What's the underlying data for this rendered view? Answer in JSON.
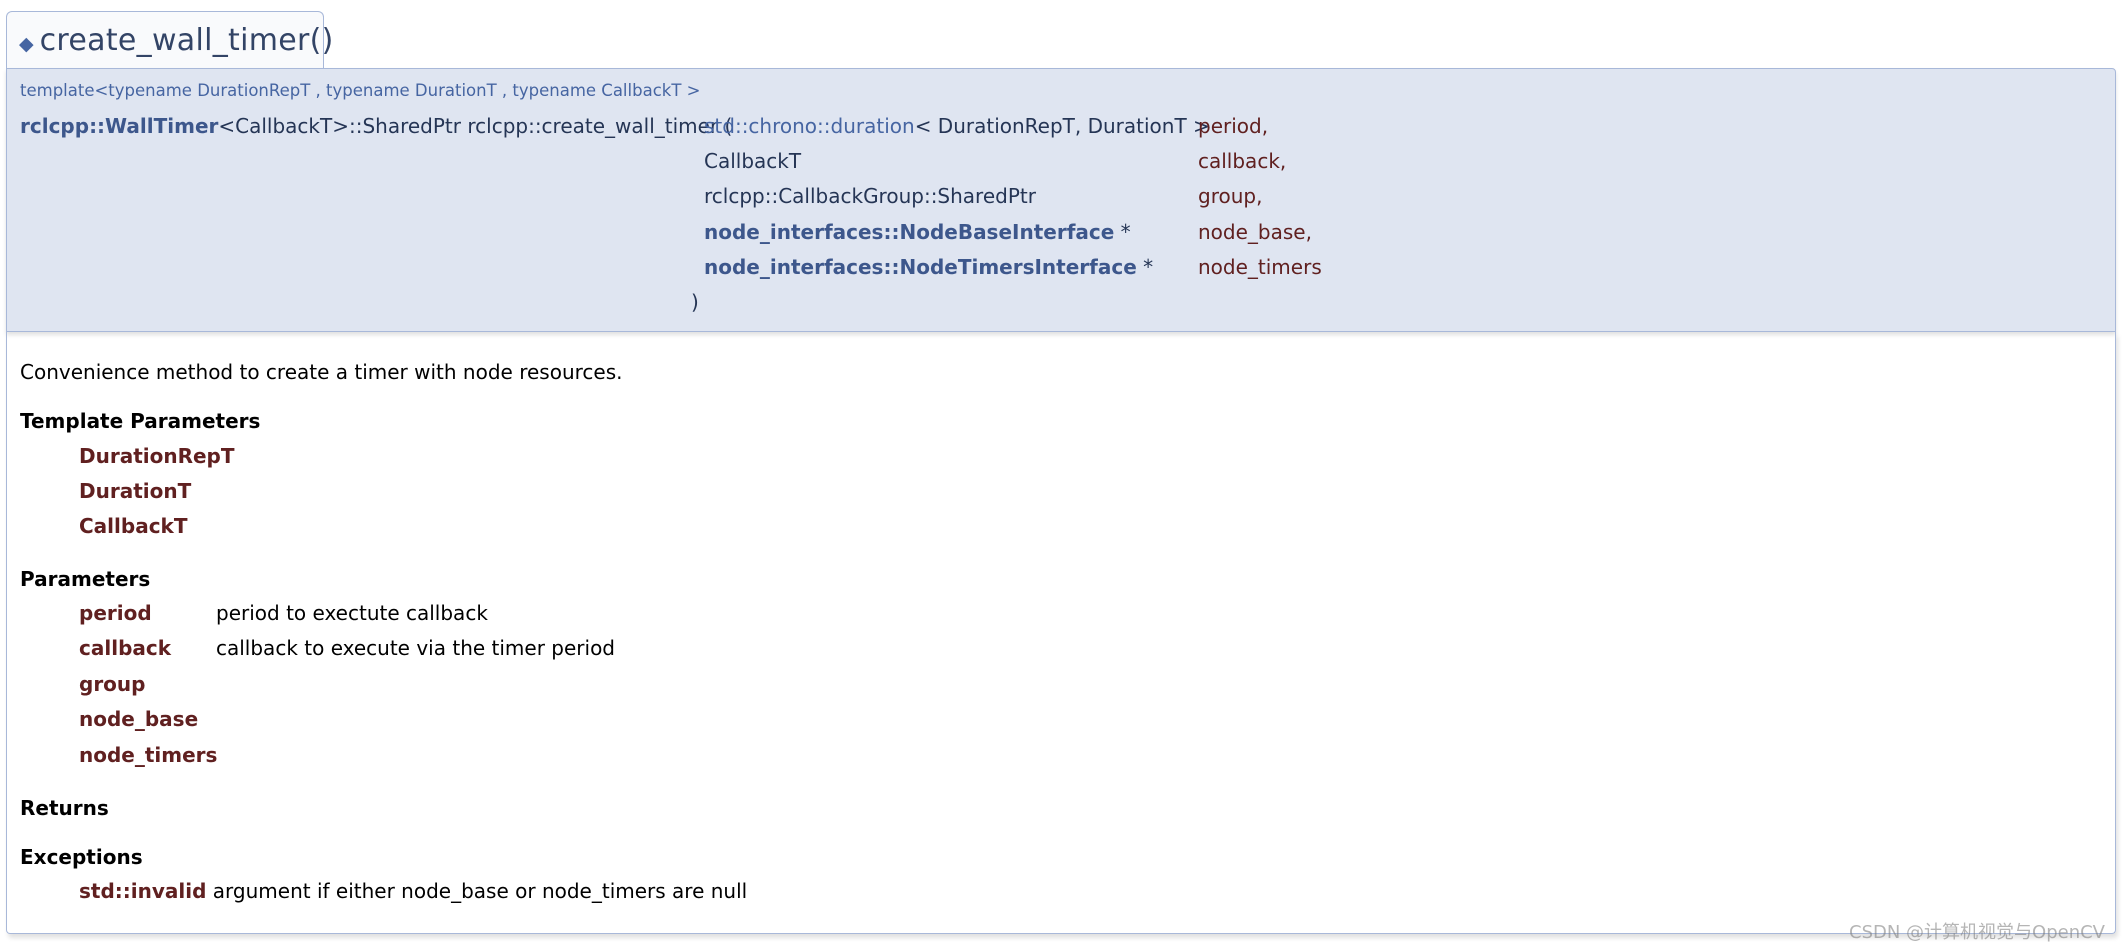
{
  "header": {
    "diamond": "◆",
    "title": "create_wall_timer()"
  },
  "prototype": {
    "template": "template<typename DurationRepT , typename DurationT , typename CallbackT >",
    "return_type_link": "rclcpp::WallTimer",
    "return_type_rest": "<CallbackT>::SharedPtr rclcpp::create_wall_timer (",
    "params": [
      {
        "type_link": "std::chrono::duration",
        "type_rest": "< DurationRepT, DurationT >",
        "name": "period,"
      },
      {
        "type_link": "",
        "type_rest": "CallbackT",
        "name": "callback,"
      },
      {
        "type_link": "",
        "type_rest": "rclcpp::CallbackGroup::SharedPtr",
        "name": "group,"
      },
      {
        "type_link": "node_interfaces::NodeBaseInterface",
        "type_rest": " *",
        "name": "node_base,"
      },
      {
        "type_link": "node_interfaces::NodeTimersInterface",
        "type_rest": " *",
        "name": "node_timers"
      }
    ],
    "close_paren": ")"
  },
  "doc": {
    "description": "Convenience method to create a timer with node resources.",
    "template_params_heading": "Template Parameters",
    "template_params": [
      "DurationRepT",
      "DurationT",
      "CallbackT"
    ],
    "params_heading": "Parameters",
    "params": [
      {
        "name": "period",
        "desc": "period to exectute callback"
      },
      {
        "name": "callback",
        "desc": "callback to execute via the timer period"
      },
      {
        "name": "group",
        "desc": ""
      },
      {
        "name": "node_base",
        "desc": ""
      },
      {
        "name": "node_timers",
        "desc": ""
      }
    ],
    "returns_heading": "Returns",
    "exceptions_heading": "Exceptions",
    "exception_name": "std::invalid",
    "exception_desc": "argument if either node_base or node_timers are null"
  },
  "watermark": "CSDN @计算机视觉与OpenCV"
}
